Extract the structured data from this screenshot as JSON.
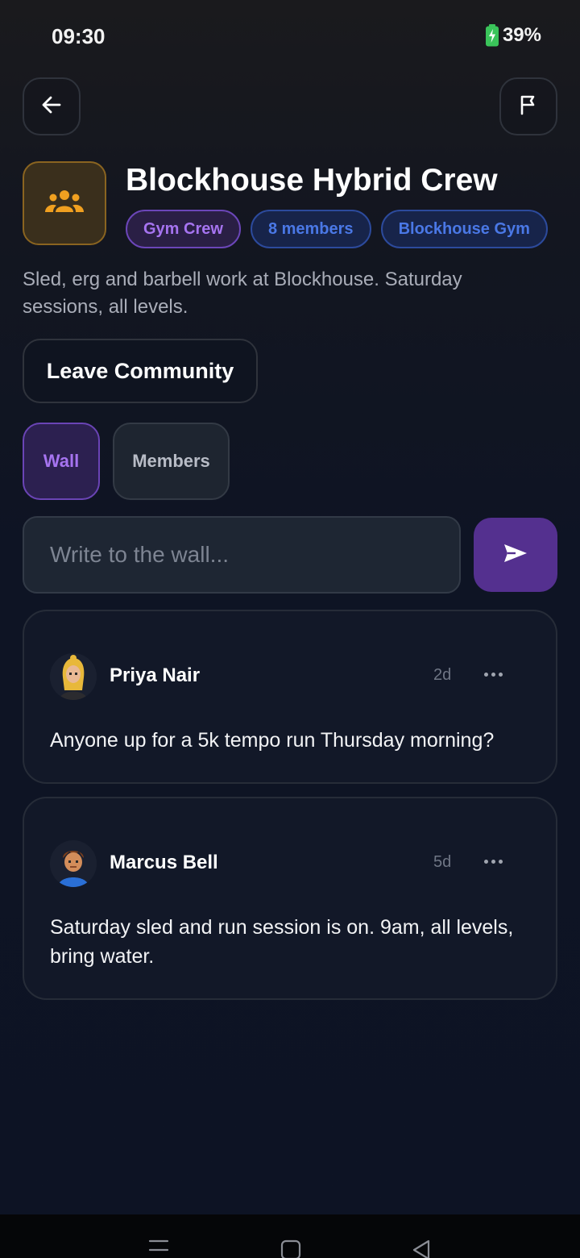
{
  "status_bar": {
    "time": "09:30",
    "battery": "39%"
  },
  "header": {
    "back_icon": "arrow-left-icon",
    "flag_icon": "flag-icon"
  },
  "community": {
    "icon": "group-icon",
    "title": "Blockhouse Hybrid Crew",
    "tags": [
      "Gym Crew",
      "8 members",
      "Blockhouse Gym"
    ],
    "description": "Sled, erg and barbell work at Blockhouse. Saturday sessions, all levels.",
    "leave_label": "Leave Community"
  },
  "tabs": [
    {
      "label": "Wall",
      "active": true
    },
    {
      "label": "Members",
      "active": false
    }
  ],
  "composer": {
    "placeholder": "Write to the wall...",
    "send_icon": "send-icon"
  },
  "posts": [
    {
      "author": "Priya Nair",
      "time": "2d",
      "text": "Anyone up for a 5k tempo run Thursday morning?"
    },
    {
      "author": "Marcus Bell",
      "time": "5d",
      "text": "Saturday sled and run session is on. 9am, all levels, bring water."
    }
  ],
  "colors": {
    "accent_purple": "#a674f0",
    "accent_blue": "#4a78e6",
    "community_gold": "#f0a020",
    "background": "#0e1424"
  }
}
